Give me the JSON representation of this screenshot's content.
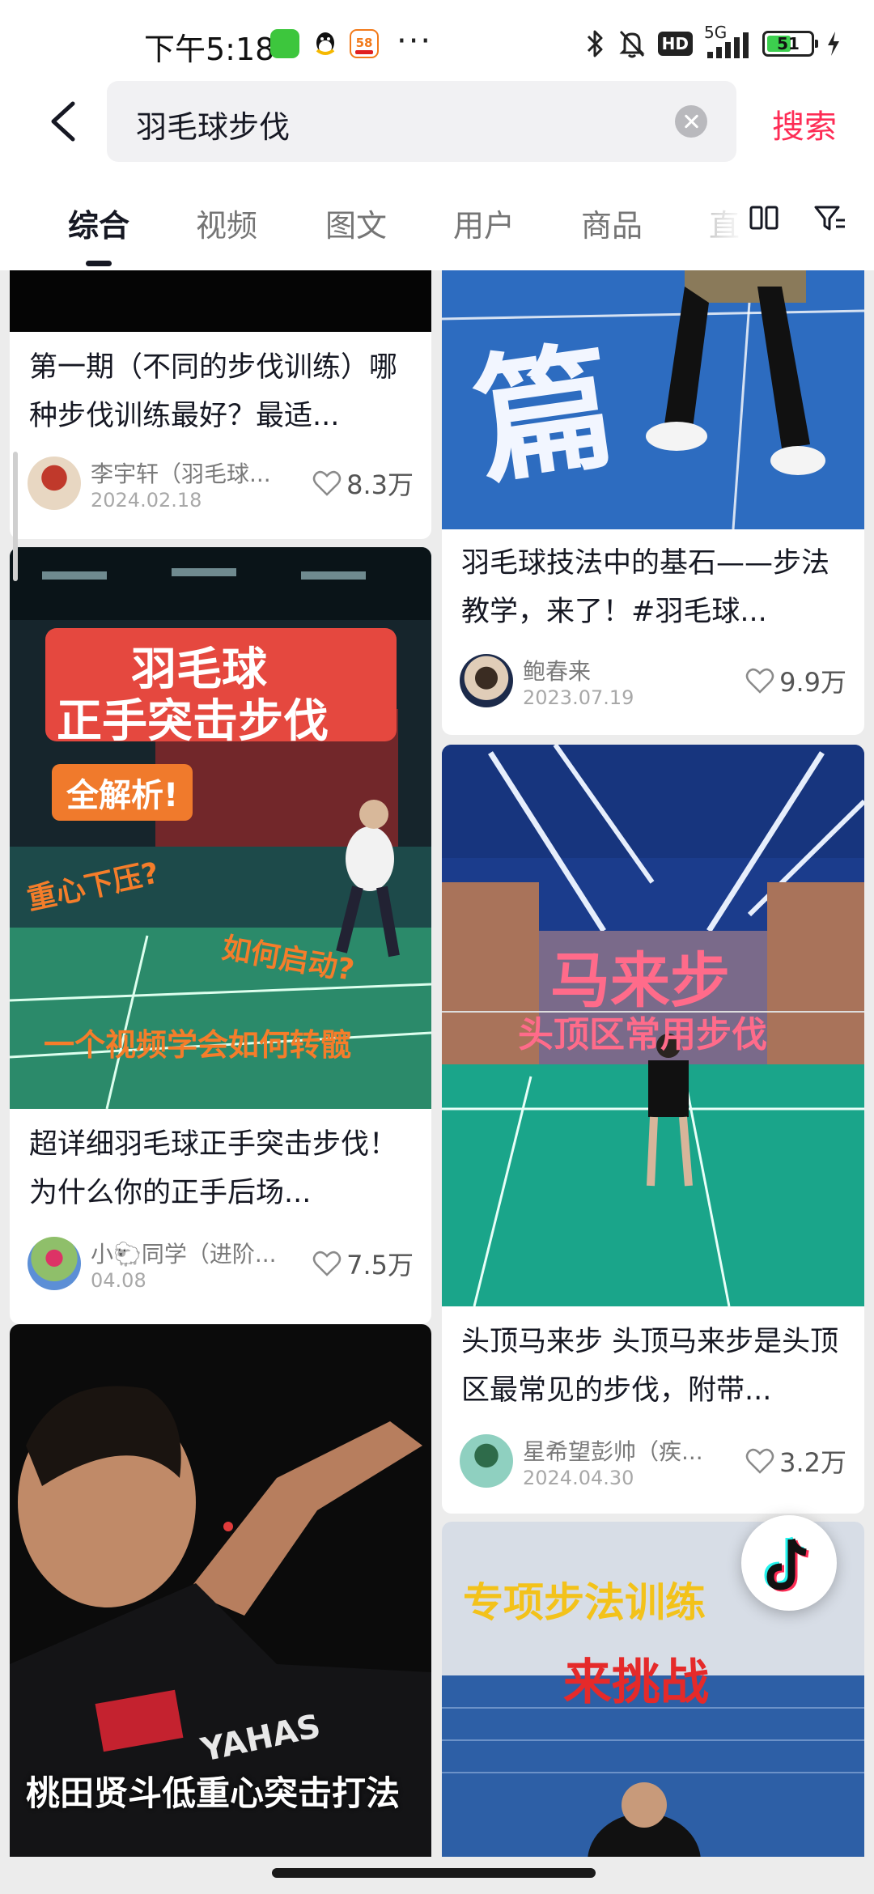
{
  "status_bar": {
    "time": "下午5:18",
    "battery": "51",
    "network": "5G",
    "hd": "HD",
    "more": "···"
  },
  "search": {
    "query": "羽毛球步伐",
    "submit_label": "搜索"
  },
  "tabs": [
    "综合",
    "视频",
    "图文",
    "用户",
    "商品",
    "直"
  ],
  "feed": {
    "cards": [
      {
        "title": "第一期（不同的步伐训练）哪种步伐训练最好？最适...",
        "author": "李宇轩（羽毛球...",
        "date": "2024.02.18",
        "likes": "8.3万"
      },
      {
        "title": "羽毛球技法中的基石——步法教学，来了！#羽毛球...",
        "author": "鲍春来",
        "date": "2023.07.19",
        "likes": "9.9万",
        "overlay": "篇"
      },
      {
        "title": "超详细羽毛球正手突击步伐！ 为什么你的正手后场...",
        "author": "小🐑同学（进阶...",
        "date": "04.08",
        "likes": "7.5万",
        "overlay": {
          "title1": "羽毛球",
          "title2": "正手突击步伐",
          "badge": "全解析!",
          "q1": "重心下压?",
          "q2": "如何启动?",
          "bottom": "一个视频学会如何转髋"
        }
      },
      {
        "title": "头顶马来步 头顶马来步是头顶区最常见的步伐，附带...",
        "author": "星希望彭帅（疾...",
        "date": "2024.04.30",
        "likes": "3.2万",
        "overlay": {
          "title1": "马来步",
          "title2": "头顶区常用步伐"
        }
      },
      {
        "overlay": "桃田贤斗低重心突击打法"
      },
      {
        "overlay": {
          "title1": "专项步法训练",
          "title2": "来挑战"
        }
      }
    ]
  },
  "fab_icon": "douyin-icon"
}
